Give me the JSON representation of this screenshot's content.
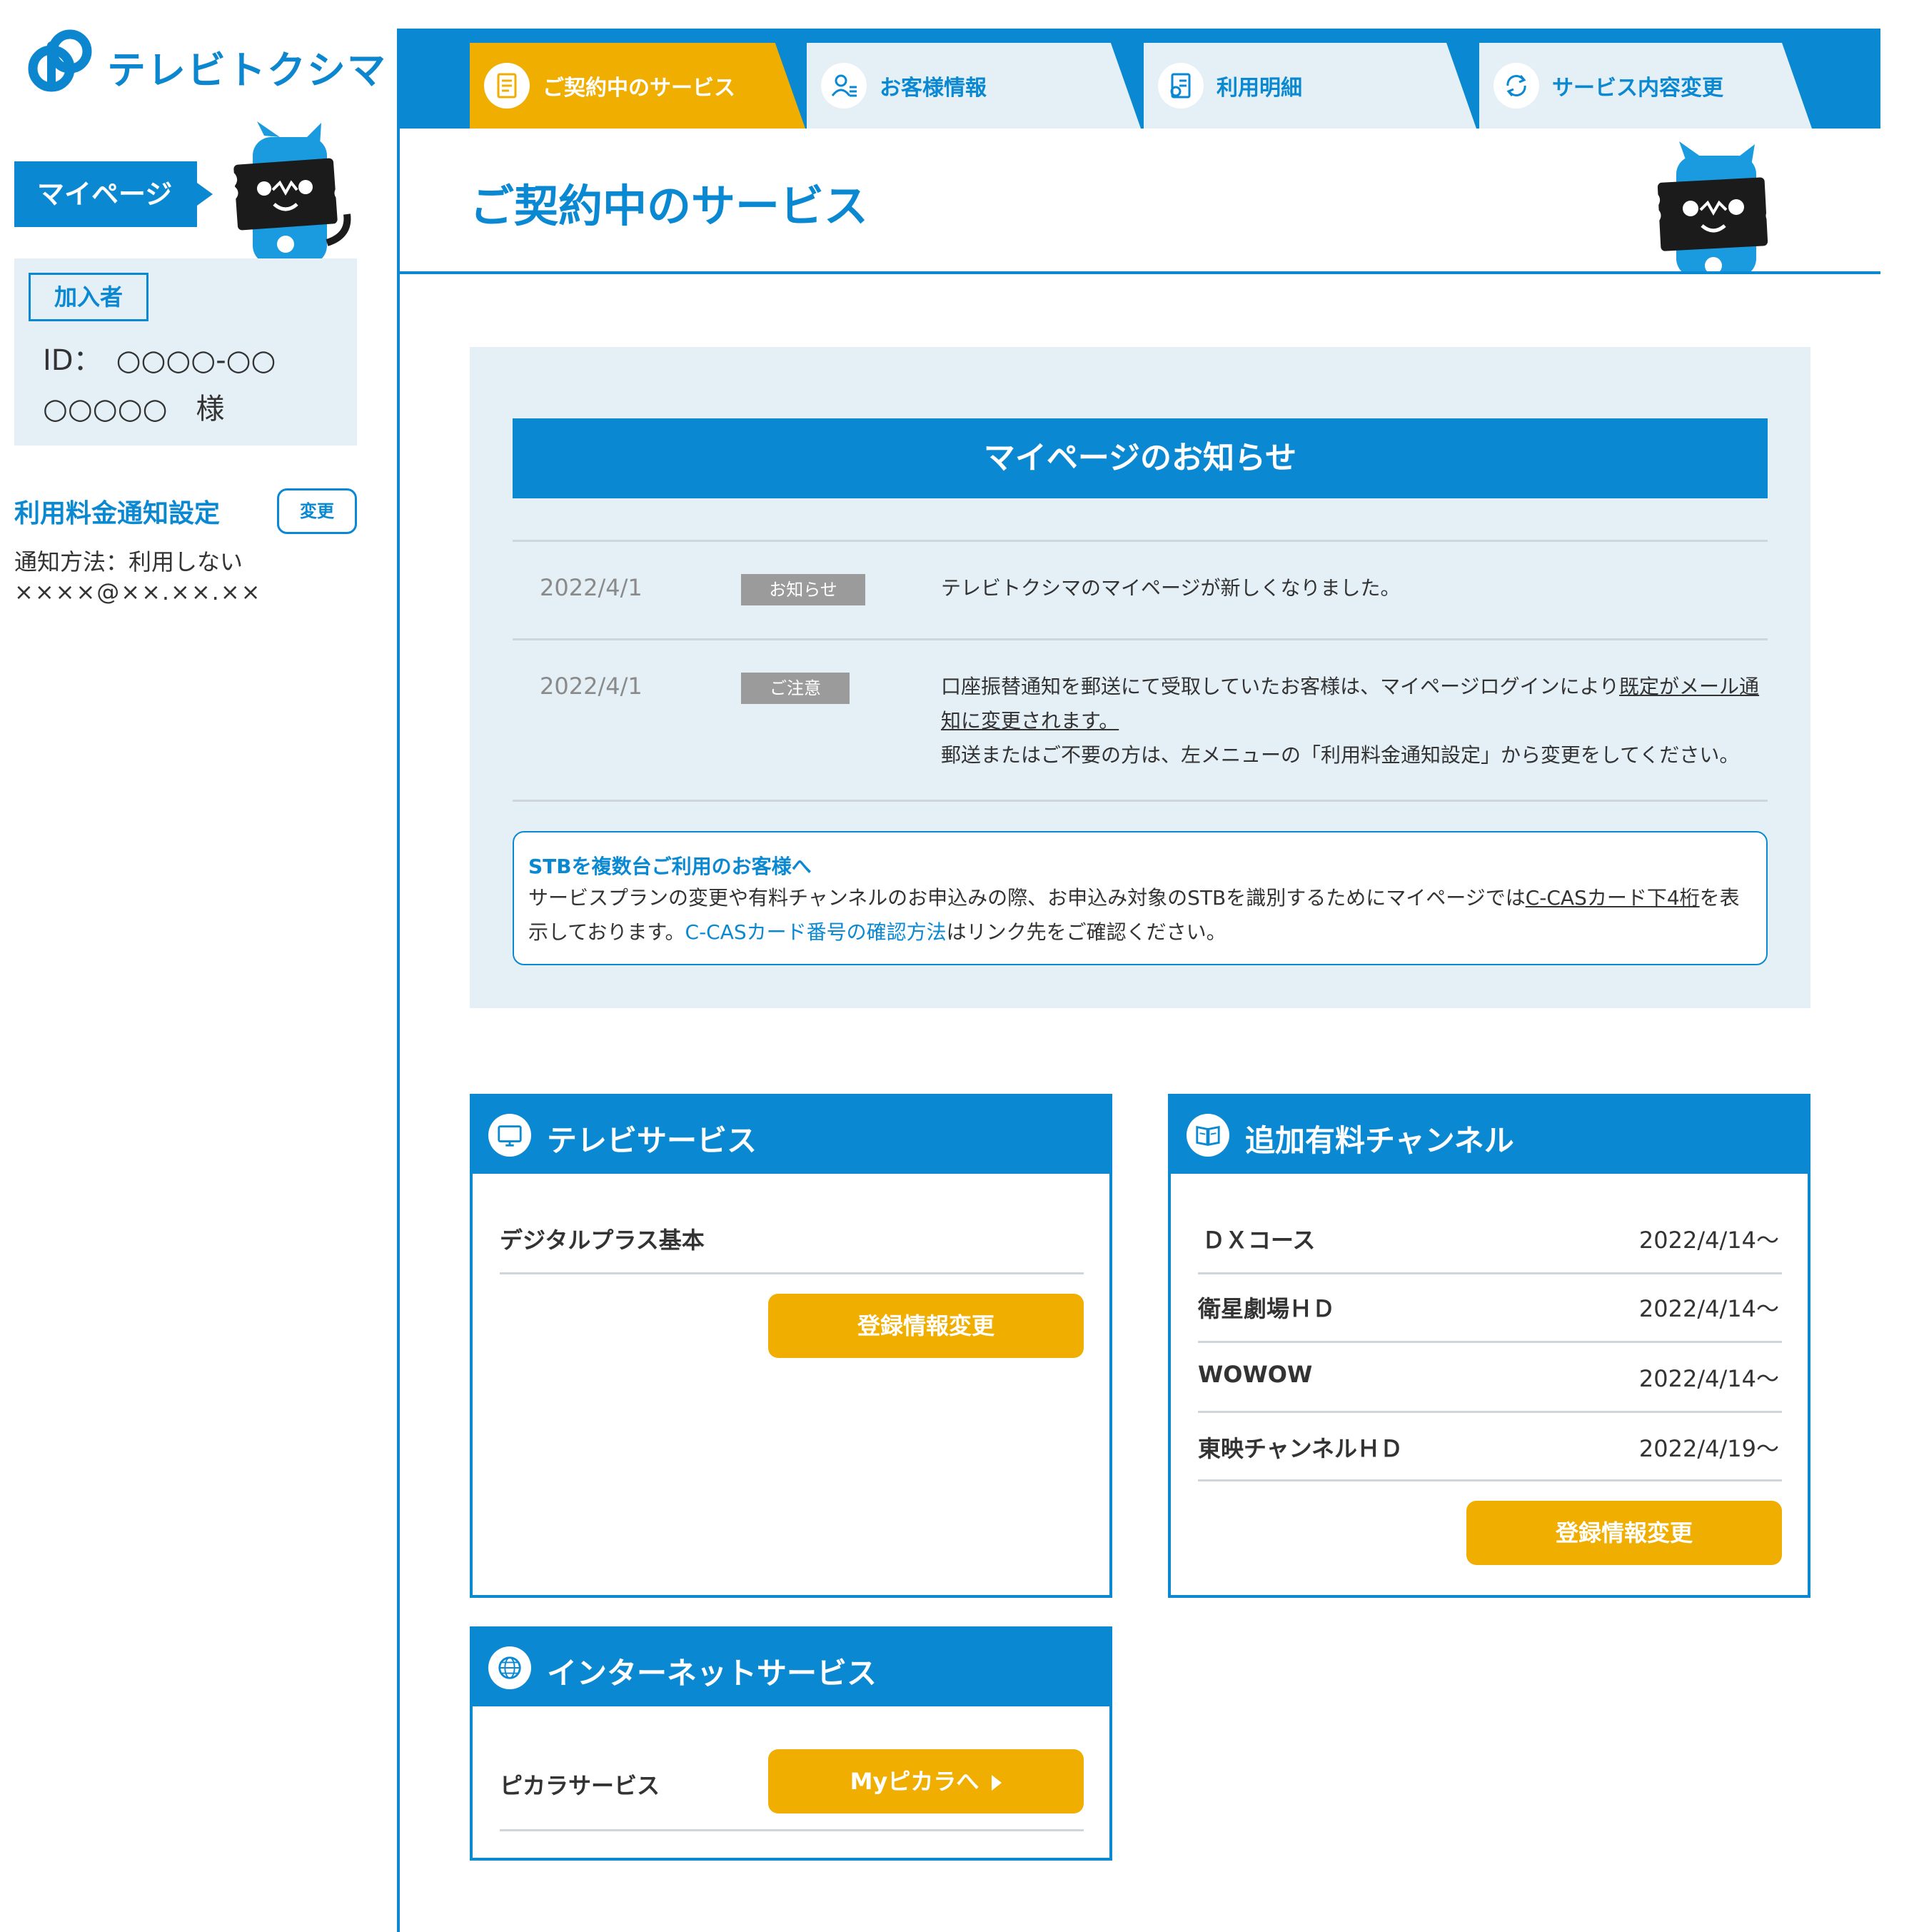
{
  "brand": {
    "name": "テレビトクシマ"
  },
  "colors": {
    "primary": "#0a89d2",
    "accent": "#f0af00",
    "panel": "#e4eff6",
    "tag": "#9b9b9b"
  },
  "sidebar": {
    "mypage_label": "マイページ",
    "subscriber": {
      "badge": "加入者",
      "id_line": "ID：　○○○○-○○",
      "name_line": "○○○○○　様"
    },
    "notification": {
      "title": "利用料金通知設定",
      "change_label": "変更",
      "method": "通知方法：利用しない",
      "email": "××××@××.××.××"
    }
  },
  "nav": {
    "tabs": [
      {
        "label": "ご契約中のサービス",
        "icon": "contract-document-icon",
        "active": true
      },
      {
        "label": "お客様情報",
        "icon": "customer-info-icon",
        "active": false
      },
      {
        "label": "利用明細",
        "icon": "billing-statement-icon",
        "active": false
      },
      {
        "label": "サービス内容変更",
        "icon": "service-change-icon",
        "active": false
      }
    ]
  },
  "main": {
    "title": "ご契約中のサービス",
    "notice": {
      "header": "マイページのお知らせ",
      "items": [
        {
          "date": "2022/4/1",
          "tag": "お知らせ",
          "text": "テレビトクシマのマイページが新しくなりました。"
        },
        {
          "date": "2022/4/1",
          "tag": "ご注意",
          "text_before": "口座振替通知を郵送にて受取していたお客様は、マイページログインにより",
          "text_underline": "既定がメール通知に変更されます。",
          "text_after": "郵送またはご不要の方は、左メニューの「利用料金通知設定」から変更をしてください。"
        }
      ],
      "stb": {
        "title": "STBを複数台ご利用のお客様へ",
        "text_1": "サービスプランの変更や有料チャンネルのお申込みの際、お申込み対象のSTBを識別するためにマイページでは",
        "text_underline": "C-CASカード下4桁",
        "text_2": "を表示しております。",
        "link": "C-CASカード番号の確認方法",
        "text_3": "はリンク先をご確認ください。"
      }
    },
    "tv_service": {
      "title": "テレビサービス",
      "icon": "tv-monitor-icon",
      "plan": "デジタルプラス基本",
      "button": "登録情報変更"
    },
    "paid_channels": {
      "title": "追加有料チャンネル",
      "icon": "channel-guide-icon",
      "items": [
        {
          "name": "ＤＸコース",
          "date": "2022/4/14〜"
        },
        {
          "name": "衛星劇場ＨＤ",
          "date": "2022/4/14〜"
        },
        {
          "name": "WOWOW",
          "date": "2022/4/14〜"
        },
        {
          "name": "東映チャンネルＨＤ",
          "date": "2022/4/19〜"
        }
      ],
      "button": "登録情報変更"
    },
    "internet_service": {
      "title": "インターネットサービス",
      "icon": "globe-icon",
      "plan": "ピカラサービス",
      "button": "Myピカラへ"
    }
  }
}
